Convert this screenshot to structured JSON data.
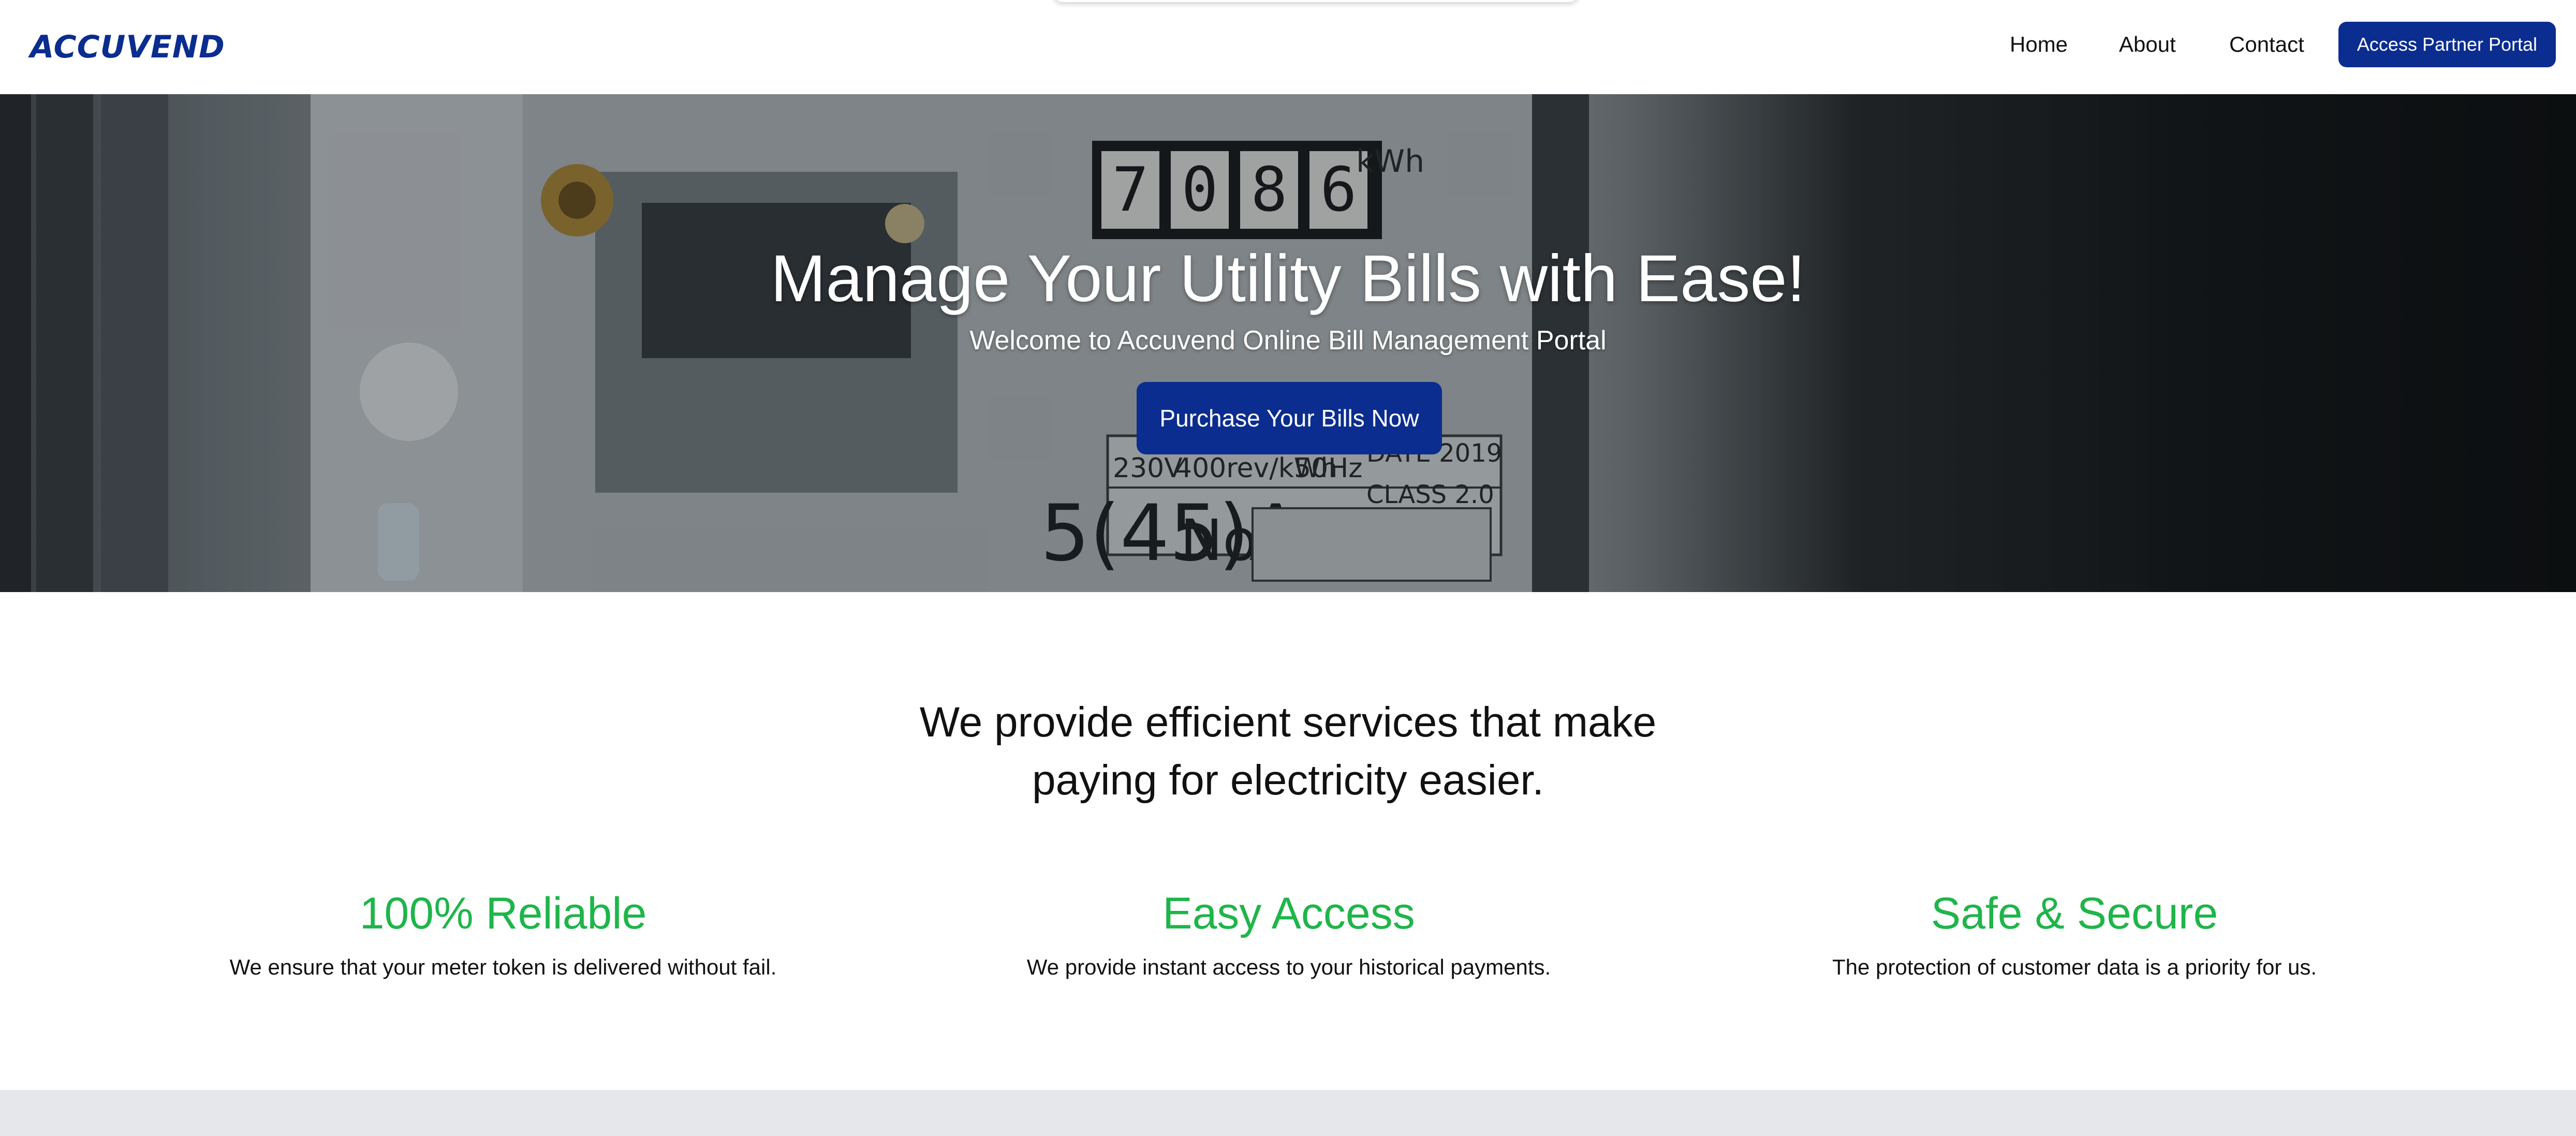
{
  "header": {
    "logo_text": "ACCUVEND",
    "nav": {
      "home": "Home",
      "about": "About",
      "contact": "Contact"
    },
    "portal_button": "Access Partner Portal"
  },
  "hero": {
    "title": "Manage Your Utility Bills with Ease!",
    "subtitle": "Welcome to Accuvend Online Bill Management Portal",
    "cta_label": "Purchase Your Bills Now",
    "meter_reading": [
      "7",
      "0",
      "8",
      "6"
    ],
    "meter_unit": "kWh",
    "meter_specs": [
      "230V",
      "400rev/kWh",
      "50Hz",
      "CLASS 2.0"
    ],
    "meter_date": "DATE 2019",
    "meter_rating": "5(45)A",
    "meter_no_label": "No."
  },
  "services": {
    "heading_line1": "We provide efficient services that make",
    "heading_line2": "paying for electricity easier.",
    "features": [
      {
        "title": "100% Reliable",
        "description": "We ensure that your meter token is delivered without fail."
      },
      {
        "title": "Easy Access",
        "description": "We provide instant access to your historical payments."
      },
      {
        "title": "Safe & Secure",
        "description": "The protection of customer data is a priority for us."
      }
    ]
  },
  "colors": {
    "brand_blue": "#0b2d8f",
    "accent_green": "#1fb54a",
    "footer_gray": "#e5e7eb"
  }
}
